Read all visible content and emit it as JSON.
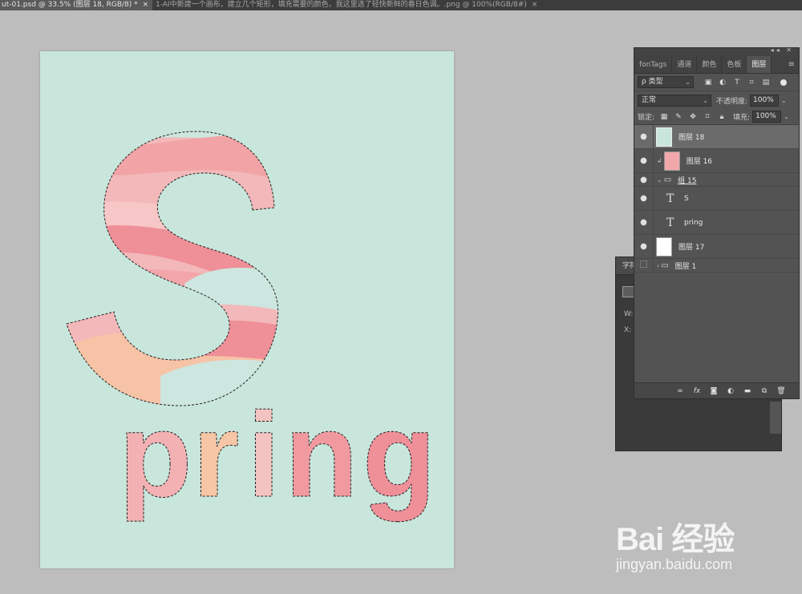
{
  "tabs": [
    {
      "title": "ut-01.psd @ 33.5% (图层 18, RGB/8) *",
      "close": "×"
    },
    {
      "title": "1-AI中新建一个画布，建立几个矩形，填充需要的颜色，我这里选了轻快新鲜的春日色调。.png @ 100%(RGB/8#)",
      "close": "×"
    }
  ],
  "canvas_art": {
    "letter": "S",
    "word": "pring"
  },
  "character_panel": {
    "title": "字符",
    "w_label": "W:",
    "x_label": "X:"
  },
  "layers_panel": {
    "tabs": [
      "fonTags",
      "通道",
      "颜色",
      "色板",
      "图层"
    ],
    "active_tab": "图层",
    "filter_label": "ρ 类型",
    "blend_mode": "正常",
    "opacity_label": "不透明度:",
    "opacity": "100%",
    "lock_label": "锁定:",
    "fill_label": "填充:",
    "fill": "100%",
    "layers": [
      {
        "name": "图层 18",
        "kind": "pixel",
        "visible": true,
        "selected": true
      },
      {
        "name": "图层 16",
        "kind": "pixel",
        "visible": true,
        "clipped": true
      },
      {
        "name": "组 15",
        "kind": "group",
        "visible": true,
        "expanded": true
      },
      {
        "name": "S",
        "kind": "text",
        "visible": true
      },
      {
        "name": "pring",
        "kind": "text",
        "visible": true
      },
      {
        "name": "图层 17",
        "kind": "pixel",
        "visible": true
      },
      {
        "name": "图层 1",
        "kind": "group",
        "visible": false,
        "expanded": false
      }
    ],
    "footer_icons": [
      "link-icon",
      "fx-icon",
      "mask-icon",
      "adjustment-icon",
      "folder-icon",
      "new-layer-icon",
      "trash-icon"
    ]
  },
  "watermark": {
    "brand": "Bai 经验",
    "url": "jingyan.baidu.com"
  }
}
